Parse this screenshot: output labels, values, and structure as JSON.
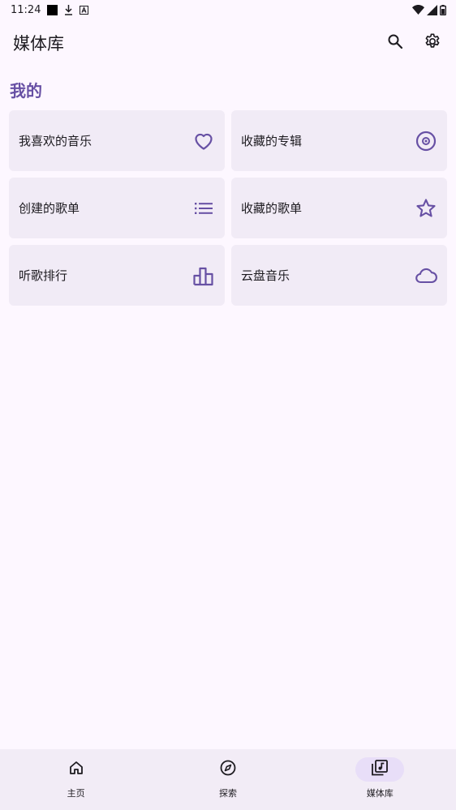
{
  "status_bar": {
    "time": "11:24",
    "icons_left": [
      "notification-square-icon",
      "download-icon",
      "app-a-icon"
    ],
    "icons_right": [
      "wifi-icon",
      "signal-icon",
      "battery-icon"
    ]
  },
  "app_bar": {
    "title": "媒体库",
    "actions": [
      "search-icon",
      "settings-gear-icon"
    ]
  },
  "section": {
    "title": "我的"
  },
  "cards": [
    {
      "label": "我喜欢的音乐",
      "icon": "heart-icon"
    },
    {
      "label": "收藏的专辑",
      "icon": "album-disc-icon"
    },
    {
      "label": "创建的歌单",
      "icon": "list-icon"
    },
    {
      "label": "收藏的歌单",
      "icon": "star-icon"
    },
    {
      "label": "听歌排行",
      "icon": "ranking-bars-icon"
    },
    {
      "label": "云盘音乐",
      "icon": "cloud-icon"
    }
  ],
  "bottom_nav": {
    "items": [
      {
        "label": "主页",
        "icon": "home-icon",
        "active": false
      },
      {
        "label": "探索",
        "icon": "compass-icon",
        "active": false
      },
      {
        "label": "媒体库",
        "icon": "library-music-icon",
        "active": true
      }
    ]
  },
  "colors": {
    "background": "#fdf7ff",
    "accent": "#6750a4",
    "card": "#f1ebf6",
    "nav_background": "#f2ecf6",
    "nav_active_pill": "#e8def8"
  }
}
